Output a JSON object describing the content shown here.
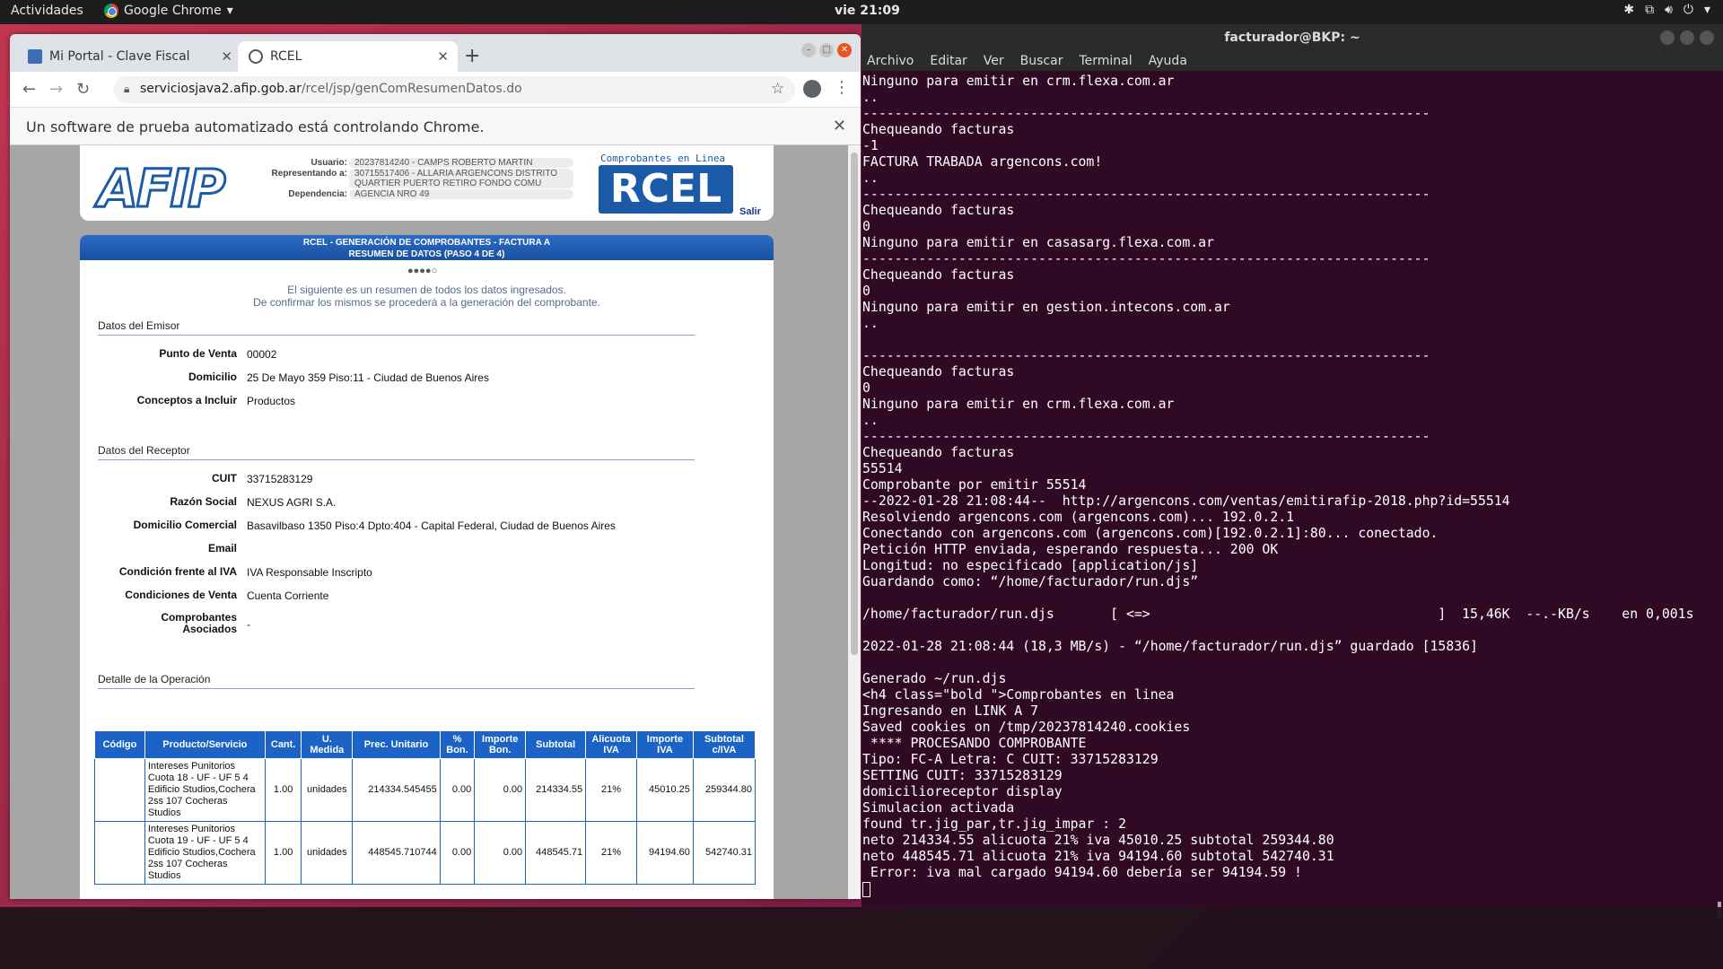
{
  "topbar": {
    "activities": "Actividades",
    "app_name": "Google Chrome",
    "clock": "vie 21:09"
  },
  "chrome": {
    "tabs": [
      {
        "title": "Mi Portal - Clave Fiscal"
      },
      {
        "title": "RCEL"
      }
    ],
    "url_host": "serviciosjava2.afip.gob.ar",
    "url_path": "/rcel/jsp/genComResumenDatos.do",
    "infobar": "Un software de prueba automatizado está controlando Chrome."
  },
  "afip": {
    "header": {
      "logo": "AFIP",
      "usuario_label": "Usuario:",
      "usuario": "20237814240 - CAMPS ROBERTO MARTIN",
      "representando_label": "Representando a:",
      "representando": "30715517406 - ALLARIA ARGENCONS DISTRITO QUARTIER PUERTO RETIRO FONDO COMU",
      "dependencia_label": "Dependencia:",
      "dependencia": "AGENCIA NRO 49",
      "rcel_tagline": "Comprobantes en Linea",
      "rcel_logo": "RCEL",
      "salir": "Salir"
    },
    "title_line1": "RCEL - GENERACIÓN DE COMPROBANTES - FACTURA A",
    "title_line2": "RESUMEN DE DATOS (PASO 4 DE 4)",
    "steps": "●●●●○",
    "intro_line1": "El siguiente es un resumen de todos los datos ingresados.",
    "intro_line2": "De confirmar los mismos se procederá a la generación del comprobante.",
    "emisor": {
      "section": "Datos del Emisor",
      "punto_venta_label": "Punto de Venta",
      "punto_venta": "00002",
      "domicilio_label": "Domicilio",
      "domicilio": "25 De Mayo 359 Piso:11 - Ciudad de Buenos Aires",
      "conceptos_label": "Conceptos a Incluir",
      "conceptos": "Productos"
    },
    "receptor": {
      "section": "Datos del Receptor",
      "cuit_label": "CUIT",
      "cuit": "33715283129",
      "razon_label": "Razón Social",
      "razon": "NEXUS AGRI S.A.",
      "domicilio_label": "Domicilio Comercial",
      "domicilio": "Basavilbaso 1350 Piso:4 Dpto:404 - Capital Federal, Ciudad de Buenos Aires",
      "email_label": "Email",
      "email": "",
      "iva_label": "Condición frente al IVA",
      "iva": "IVA Responsable Inscripto",
      "venta_label": "Condiciones de Venta",
      "venta": "Cuenta Corriente",
      "asociados_label_1": "Comprobantes",
      "asociados_label_2": "Asociados",
      "asociados": "-"
    },
    "detalle": {
      "section": "Detalle de la Operación",
      "headers": [
        "Código",
        "Producto/Servicio",
        "Cant.",
        "U. Medida",
        "Prec. Unitario",
        "% Bon.",
        "Importe Bon.",
        "Subtotal",
        "Alicuota IVA",
        "Importe IVA",
        "Subtotal c/IVA"
      ],
      "rows": [
        {
          "codigo": "",
          "producto": "Intereses Punitorios Cuota 18 - UF - UF 5 4 Edificio Studios,Cochera 2ss 107 Cocheras Studios",
          "cant": "1.00",
          "umedida": "unidades",
          "precio": "214334.545455",
          "bon": "0.00",
          "importe_bon": "0.00",
          "subtotal": "214334.55",
          "alicuota": "21%",
          "importe_iva": "45010.25",
          "subtotal_iva": "259344.80"
        },
        {
          "codigo": "",
          "producto": "Intereses Punitorios Cuota 19 - UF - UF 5 4 Edificio Studios,Cochera 2ss 107 Cocheras Studios",
          "cant": "1.00",
          "umedida": "unidades",
          "precio": "448545.710744",
          "bon": "0.00",
          "importe_bon": "0.00",
          "subtotal": "448545.71",
          "alicuota": "21%",
          "importe_iva": "94194.60",
          "subtotal_iva": "542740.31"
        }
      ]
    }
  },
  "terminal": {
    "title": "facturador@BKP: ~",
    "menu": [
      "Archivo",
      "Editar",
      "Ver",
      "Buscar",
      "Terminal",
      "Ayuda"
    ],
    "lines": [
      "Ninguno para emitir en crm.flexa.com.ar",
      "..",
      "-----------------------------------------------------------------------",
      "Chequeando facturas",
      "-1",
      "FACTURA TRABADA argencons.com!",
      "..",
      "-----------------------------------------------------------------------",
      "Chequeando facturas",
      "0",
      "Ninguno para emitir en casasarg.flexa.com.ar",
      "-----------------------------------------------------------------------",
      "Chequeando facturas",
      "0",
      "Ninguno para emitir en gestion.intecons.com.ar",
      "..",
      "",
      "-----------------------------------------------------------------------",
      "Chequeando facturas",
      "0",
      "Ninguno para emitir en crm.flexa.com.ar",
      "..",
      "-----------------------------------------------------------------------",
      "Chequeando facturas",
      "55514",
      "Comprobante por emitir 55514",
      "--2022-01-28 21:08:44--  http://argencons.com/ventas/emitirafip-2018.php?id=55514",
      "Resolviendo argencons.com (argencons.com)... 192.0.2.1",
      "Conectando con argencons.com (argencons.com)[192.0.2.1]:80... conectado.",
      "Petición HTTP enviada, esperando respuesta... 200 OK",
      "Longitud: no especificado [application/js]",
      "Guardando como: “/home/facturador/run.djs”",
      "",
      "/home/facturador/run.djs       [ <=>                                    ]  15,46K  --.-KB/s    en 0,001s",
      "",
      "2022-01-28 21:08:44 (18,3 MB/s) - “/home/facturador/run.djs” guardado [15836]",
      "",
      "Generado ~/run.djs",
      "<h4 class=\"bold \">Comprobantes en linea",
      "Ingresando en LINK A 7",
      "Saved cookies on /tmp/20237814240.cookies",
      " **** PROCESANDO COMPROBANTE",
      "Tipo: FC-A Letra: C CUIT: 33715283129",
      "SETTING CUIT: 33715283129",
      "domicilioreceptor display",
      "Simulacion activada",
      "found tr.jig_par,tr.jig_impar : 2",
      "neto 214334.55 alicuota 21% iva 45010.25 subtotal 259344.80",
      "neto 448545.71 alicuota 21% iva 94194.60 subtotal 542740.31",
      " Error: iva mal cargado 94194.60 debería ser 94194.59 !"
    ]
  }
}
